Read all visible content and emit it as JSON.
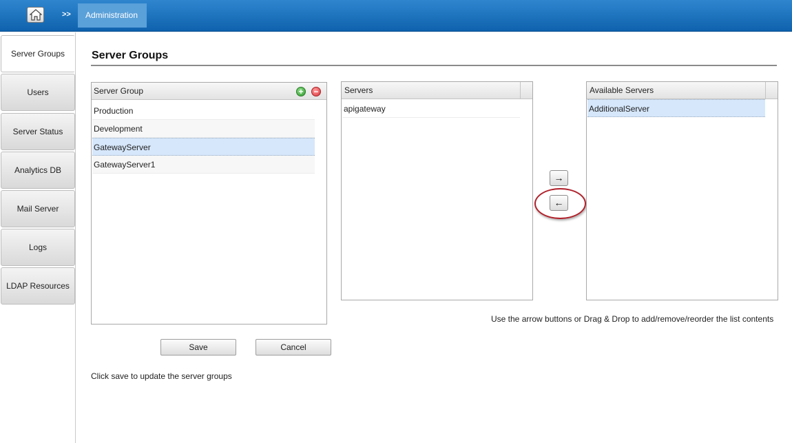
{
  "header": {
    "home_icon": "home-icon",
    "separator": ">>",
    "breadcrumb": "Administration",
    "colors": {
      "bar": "#1a6fbf",
      "crumb": "#5aa0d9"
    }
  },
  "sidebar": {
    "items": [
      {
        "label": "Server Groups",
        "active": true
      },
      {
        "label": "Users"
      },
      {
        "label": "Server Status"
      },
      {
        "label": "Analytics DB"
      },
      {
        "label": "Mail Server"
      },
      {
        "label": "Logs"
      },
      {
        "label": "LDAP Resources"
      }
    ]
  },
  "main": {
    "title": "Server Groups",
    "server_groups": {
      "header": "Server Group",
      "add_icon": "add-icon",
      "remove_icon": "remove-icon",
      "rows": [
        "Production",
        "Development",
        "GatewayServer",
        "GatewayServer1"
      ],
      "selected": "GatewayServer"
    },
    "servers": {
      "header": "Servers",
      "rows": [
        "apigateway"
      ]
    },
    "available_servers": {
      "header": "Available Servers",
      "rows": [
        "AdditionalServer"
      ],
      "selected": "AdditionalServer"
    },
    "arrows": {
      "add": "arrow-right-icon",
      "remove": "arrow-left-icon"
    },
    "hint": "Use the arrow buttons or Drag & Drop to add/remove/reorder the list contents",
    "save_label": "Save",
    "cancel_label": "Cancel",
    "footer_note": "Click save to update the server groups"
  }
}
